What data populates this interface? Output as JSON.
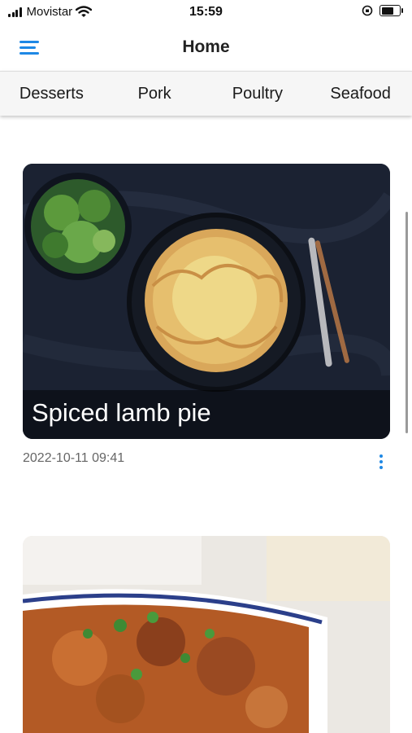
{
  "status_bar": {
    "carrier": "Movistar",
    "time": "15:59",
    "battery_level": 0.6,
    "icons": [
      "signal-icon",
      "wifi-icon",
      "orientation-lock-icon",
      "battery-icon"
    ]
  },
  "header": {
    "title": "Home",
    "menu_icon": "hamburger-menu-icon"
  },
  "tabs": [
    {
      "label": "Desserts"
    },
    {
      "label": "Pork"
    },
    {
      "label": "Poultry"
    },
    {
      "label": "Seafood"
    }
  ],
  "recipes": [
    {
      "title": "Spiced lamb pie",
      "timestamp": "2022-10-11 09:41",
      "more_icon": "more-vertical-icon"
    },
    {
      "title": "",
      "timestamp": ""
    }
  ],
  "colors": {
    "accent": "#1e88e5",
    "tab_bar_bg": "#f6f6f6",
    "meta_text": "#666666"
  }
}
